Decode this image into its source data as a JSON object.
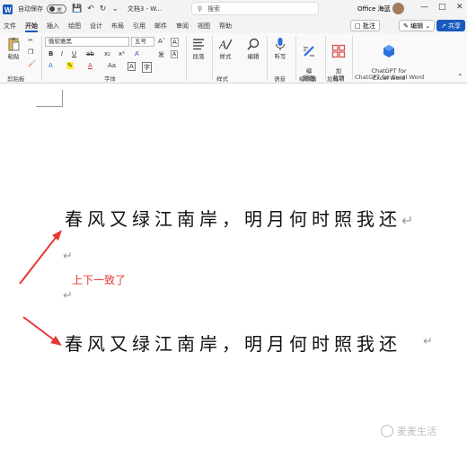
{
  "titlebar": {
    "autosave_label": "自动保存",
    "autosave_state": "关",
    "document_title": "文档3 - W...",
    "search_placeholder": "搜索",
    "account_name": "Office 海蓝"
  },
  "tabs": [
    "文件",
    "开始",
    "插入",
    "绘图",
    "设计",
    "布局",
    "引用",
    "邮件",
    "审阅",
    "视图",
    "帮助"
  ],
  "active_tab": "开始",
  "ribbon_right": {
    "comment_label": "批注",
    "edit_label": "编辑",
    "share_label": "共享"
  },
  "ribbon": {
    "paste_label": "粘贴",
    "font_name": "微软雅黑",
    "font_size": "五号",
    "paragraph_label": "段落",
    "styles_label": "样式",
    "editing_label": "编辑",
    "dictate_label": "听写",
    "editor_label": "编\n辑器",
    "addins_label": "加\n载项",
    "chatgpt_label": "ChatGPT for\nExcel Word",
    "groups": {
      "clipboard": "剪贴板",
      "font": "字体",
      "styles": "样式",
      "voice": "语音",
      "editor": "编辑器",
      "addins": "加载项",
      "chatgpt": "ChatGPT for Excel Word"
    }
  },
  "document": {
    "line1": "春风又绿江南岸，明月何时照我还",
    "line2": "春风又绿江南岸，明月何时照我还",
    "note": "上下一致了",
    "para_mark": "↵",
    "arrow_color": "#e53935"
  },
  "watermark": "麦麦生活"
}
